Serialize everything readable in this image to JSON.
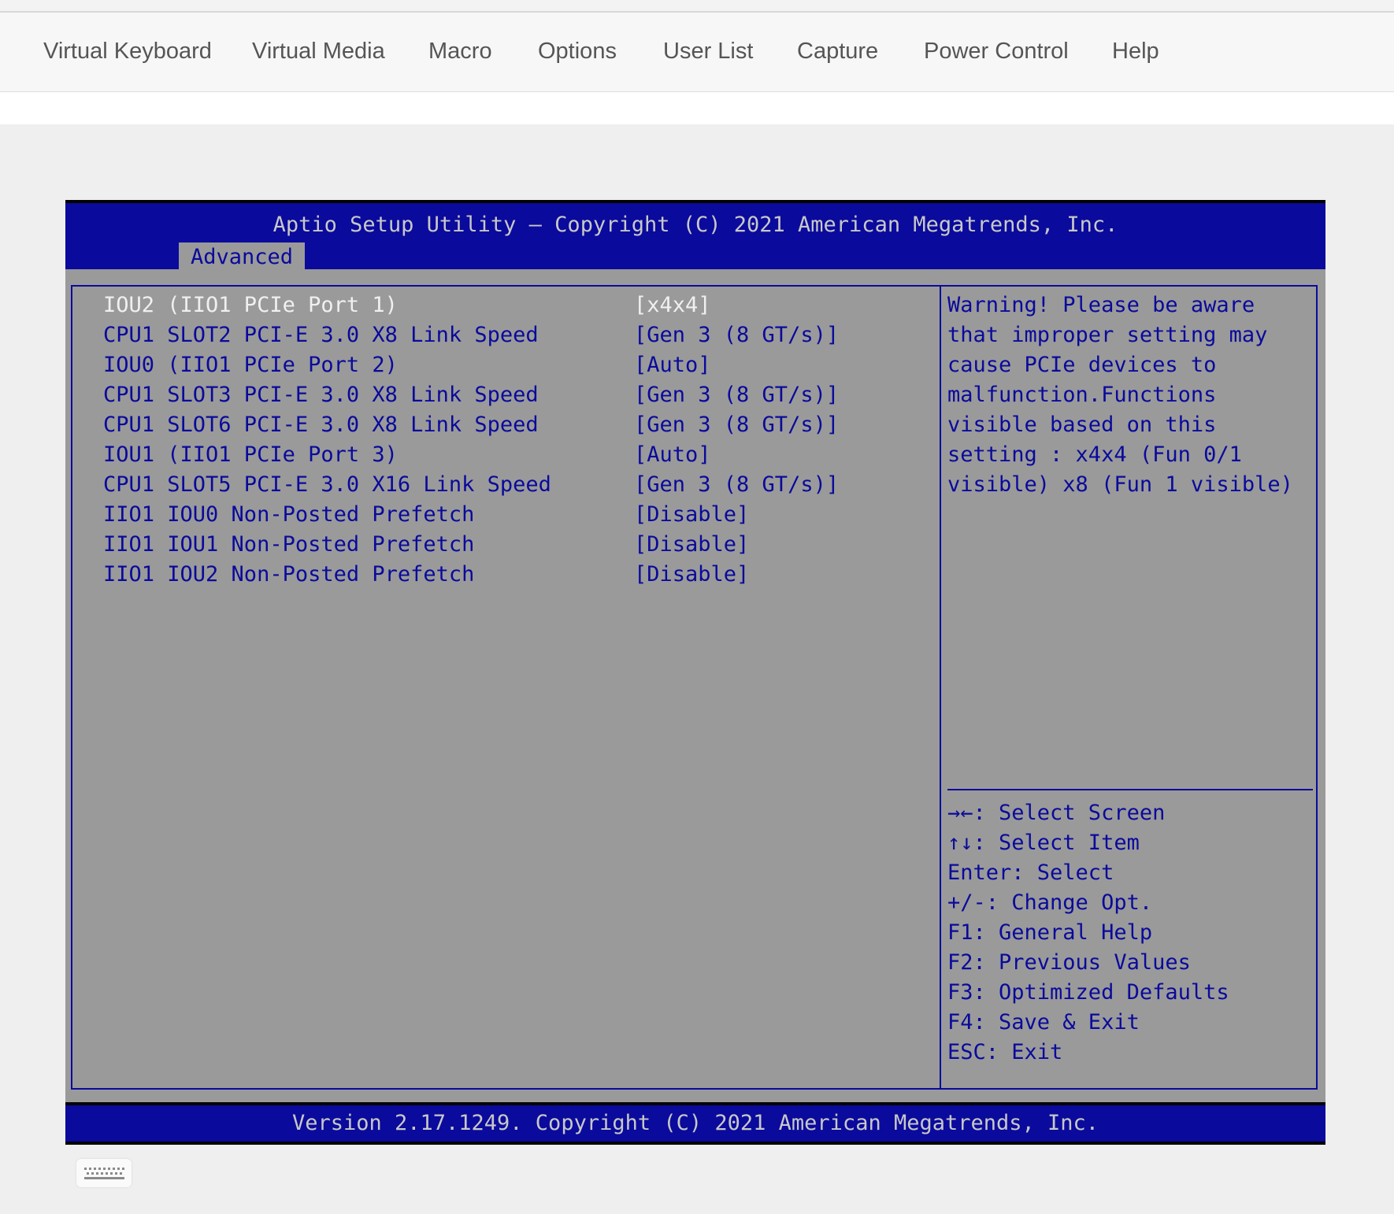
{
  "menu": [
    "Virtual Keyboard",
    "Virtual Media",
    "Macro",
    "Options",
    "User List",
    "Capture",
    "Power Control",
    "Help"
  ],
  "bios": {
    "title": "Aptio Setup Utility – Copyright (C) 2021 American Megatrends, Inc.",
    "active_tab": "Advanced",
    "options": [
      {
        "name": "IOU2 (IIO1 PCIe Port 1)",
        "value": "[x4x4]",
        "selected": true
      },
      {
        "name": "CPU1 SLOT2 PCI-E 3.0 X8 Link Speed",
        "value": "[Gen 3 (8 GT/s)]"
      },
      {
        "name": "IOU0 (IIO1 PCIe Port 2)",
        "value": "[Auto]"
      },
      {
        "name": "CPU1 SLOT3 PCI-E 3.0 X8 Link Speed",
        "value": "[Gen 3 (8 GT/s)]"
      },
      {
        "name": "CPU1 SLOT6 PCI-E 3.0 X8 Link Speed",
        "value": "[Gen 3 (8 GT/s)]"
      },
      {
        "name": "IOU1 (IIO1 PCIe Port 3)",
        "value": "[Auto]"
      },
      {
        "name": "CPU1 SLOT5 PCI-E 3.0 X16 Link Speed",
        "value": "[Gen 3 (8 GT/s)]"
      },
      {
        "name": "IIO1 IOU0 Non-Posted Prefetch",
        "value": "[Disable]"
      },
      {
        "name": "IIO1 IOU1 Non-Posted Prefetch",
        "value": "[Disable]"
      },
      {
        "name": "IIO1 IOU2 Non-Posted Prefetch",
        "value": "[Disable]"
      }
    ],
    "help_text": [
      "Warning! Please be aware",
      "that improper setting may",
      "cause PCIe devices to",
      "malfunction.Functions",
      "visible based on this",
      "setting : x4x4 (Fun 0/1",
      "visible) x8 (Fun 1 visible)"
    ],
    "key_help": [
      "→←: Select Screen",
      "↑↓: Select Item",
      "Enter: Select",
      "+/-: Change Opt.",
      "F1: General Help",
      "F2: Previous Values",
      "F3: Optimized Defaults",
      "F4: Save & Exit",
      "ESC: Exit"
    ],
    "footer": "Version 2.17.1249. Copyright (C) 2021 American Megatrends, Inc."
  },
  "colors": {
    "bios_blue": "#0a0a9c",
    "bios_gray": "#9a9a9a",
    "selected_text": "#f0f0f0"
  },
  "icons": {
    "keyboard_button": "keyboard-icon"
  }
}
